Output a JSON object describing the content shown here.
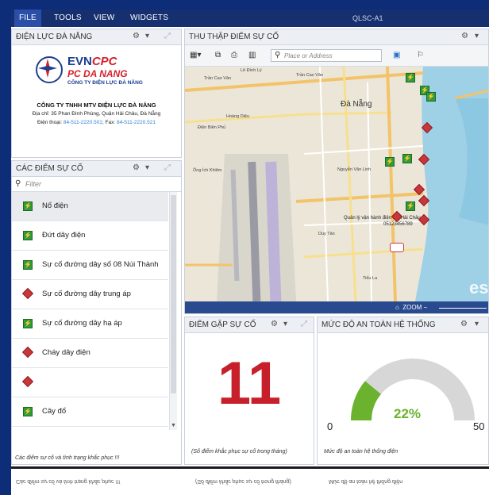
{
  "menu": {
    "items": [
      "FILE",
      "TOOLS",
      "VIEW",
      "WIDGETS"
    ],
    "window_title": "QLSC-A1"
  },
  "left_top_panel": {
    "title": "ĐIỆN LỰC ĐÀ NẴNG",
    "brand_evn": "EVN",
    "brand_cpc": "CPC",
    "brand_pc": "PC DA NANG",
    "brand_sub": "CÔNG TY ĐIỆN LỰC ĐÀ NẴNG",
    "company": "CÔNG TY TNHH MTV ĐIỆN LỰC ĐÀ NẴNG",
    "address": "Địa chỉ: 35 Phan Đình Phùng, Quận Hải Châu, Đà Nẵng",
    "phone_label": "Điện thoại:",
    "phone": "84-511-2220.501",
    "fax_label": "; Fax:",
    "fax": "84-511-2220.521"
  },
  "incident_list": {
    "title": "CÁC ĐIỂM SỰ CỐ",
    "filter_placeholder": "Filter",
    "items": [
      {
        "label": "Nổ điện",
        "icon": "green-power-icon"
      },
      {
        "label": "Đứt dây điện",
        "icon": "green-power-icon"
      },
      {
        "label": "Sự cố đường dây số 08 Núi Thành",
        "icon": "green-power-icon"
      },
      {
        "label": "Sự cố đường dây trung áp",
        "icon": "red-diamond-icon"
      },
      {
        "label": "Sự cố đường dây hạ áp",
        "icon": "green-power-icon"
      },
      {
        "label": "Cháy dây điện",
        "icon": "red-diamond-icon"
      },
      {
        "label": "",
        "icon": "red-diamond-icon"
      },
      {
        "label": "Cây đổ",
        "icon": "green-power-icon"
      },
      {
        "label": "",
        "icon": "red-diamond-icon"
      }
    ],
    "footnote": "Các điểm sự cố và tình trạng khắc phục !!!"
  },
  "map_panel": {
    "title": "THU THẬP ĐIỂM SỰ CỐ",
    "search_placeholder": "Place or Address",
    "city_label": "Đà Nẵng",
    "office_label": "Quản lý vận hành điện lực Hải Châu",
    "office_phone": "05123456789",
    "zoom_label": "ZOOM",
    "street_labels": [
      "Trần Cao Vân",
      "Trần Cao Vân",
      "Lê Đình Lý",
      "Nguyễn Văn Linh",
      "Duy Tân",
      "Tiểu La",
      "Ông Ích Khiêm",
      "Hoàng Diệu",
      "Điện Biên Phủ"
    ],
    "watermark": "es"
  },
  "incident_count_panel": {
    "title": "ĐIỂM GẶP SỰ CỐ",
    "value": "11",
    "caption": "(Số điểm khắc phục sự cố trong tháng)"
  },
  "safety_panel": {
    "title": "MỨC ĐỘ AN TOÀN HỆ THỐNG",
    "gauge_fraction": 0.22,
    "value_text": "22%",
    "min_label": "0",
    "max_label": "50",
    "caption": "Mức độ an toàn hệ thống điện"
  },
  "colors": {
    "menubar": "#16306f",
    "brand_blue": "#1a3b91",
    "brand_red": "#d4202a",
    "gauge_fill": "#6bb32e",
    "gauge_track": "#d7d7d7",
    "big_number": "#c8202a"
  }
}
